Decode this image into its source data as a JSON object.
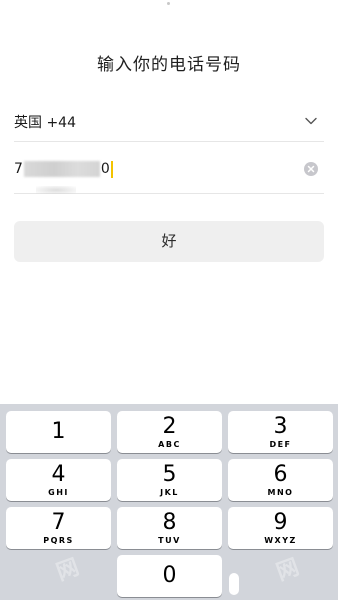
{
  "header": {
    "title": "输入你的电话号码"
  },
  "country": {
    "label": "英国 +44"
  },
  "phone": {
    "prefix": "7",
    "suffix": "0"
  },
  "submit": {
    "label": "好"
  },
  "keypad": {
    "keys": [
      {
        "num": "1",
        "letters": ""
      },
      {
        "num": "2",
        "letters": "ABC"
      },
      {
        "num": "3",
        "letters": "DEF"
      },
      {
        "num": "4",
        "letters": "GHI"
      },
      {
        "num": "5",
        "letters": "JKL"
      },
      {
        "num": "6",
        "letters": "MNO"
      },
      {
        "num": "7",
        "letters": "PQRS"
      },
      {
        "num": "8",
        "letters": "TUV"
      },
      {
        "num": "9",
        "letters": "WXYZ"
      },
      {
        "num": "0",
        "letters": ""
      }
    ]
  },
  "colors": {
    "caret": "#f3c300",
    "keyboard_bg": "#d2d5db",
    "button_bg": "#efefef"
  }
}
